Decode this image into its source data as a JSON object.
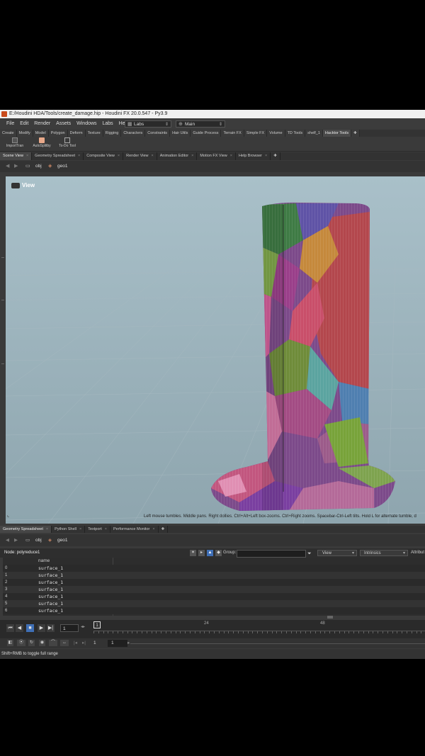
{
  "window": {
    "title": "E:/Houdini HDA/Tools/create_damage.hip - Houdini FX 20.0.547 - Py3.9"
  },
  "menu": [
    "File",
    "Edit",
    "Render",
    "Assets",
    "Windows",
    "Labs",
    "Help"
  ],
  "desktop_combo": "Labs",
  "main_combo": "Main",
  "shelf_tabs": [
    "Create",
    "Modify",
    "Model",
    "Polygon",
    "Deform",
    "Texture",
    "Rigging",
    "Characters",
    "Constraints",
    "Hair Utils",
    "Guide Process",
    "Terrain FX",
    "Simple FX",
    "Volume",
    "TD Tools",
    "shelf_1",
    "Hacktor Tools"
  ],
  "shelf_tools": [
    "ImportTran",
    "AutoSplitby",
    "To-Do Tool"
  ],
  "pane_tabs": [
    "Scene View",
    "Geometry Spreadsheet",
    "Composite View",
    "Render View",
    "Animation Editor",
    "Motion FX View",
    "Help Browser"
  ],
  "path": {
    "root": "obj",
    "node": "geo1"
  },
  "viewport": {
    "label": "View",
    "hint": "Left mouse tumbles. Middle pans. Right dollies. Ctrl+Alt+Left box-zooms. Ctrl+Right zooms. Spacebar-Ctrl-Left tilts. Hold L for alternate tumble, d"
  },
  "bottom_tabs": [
    "Geometry Spreadsheet",
    "Python Shell",
    "Textport",
    "Performance Monitor"
  ],
  "bottom_path": {
    "root": "obj",
    "node": "geo1"
  },
  "spreadsheet": {
    "node_label": "Node: polyreduce1",
    "group_label": "Group:",
    "view_label": "View",
    "intrinsics_label": "Intrinsics",
    "attributes_label": "Attribut",
    "column": "name",
    "rows": [
      {
        "index": "0",
        "name": "surface_1"
      },
      {
        "index": "1",
        "name": "surface_1"
      },
      {
        "index": "2",
        "name": "surface_1"
      },
      {
        "index": "3",
        "name": "surface_1"
      },
      {
        "index": "4",
        "name": "surface_1"
      },
      {
        "index": "5",
        "name": "surface_1"
      },
      {
        "index": "6",
        "name": "surface_1"
      }
    ]
  },
  "timeline": {
    "current_frame": "1",
    "frame_marker": "1",
    "tick_24": "24",
    "tick_48": "48"
  },
  "range": {
    "start": "1",
    "end": "1"
  },
  "status": "Shift+RMB to toggle full range",
  "colors": {
    "accent": "#3f6fb6",
    "viewport_top": "#a9c0c9",
    "viewport_bottom": "#8ea5ae"
  }
}
